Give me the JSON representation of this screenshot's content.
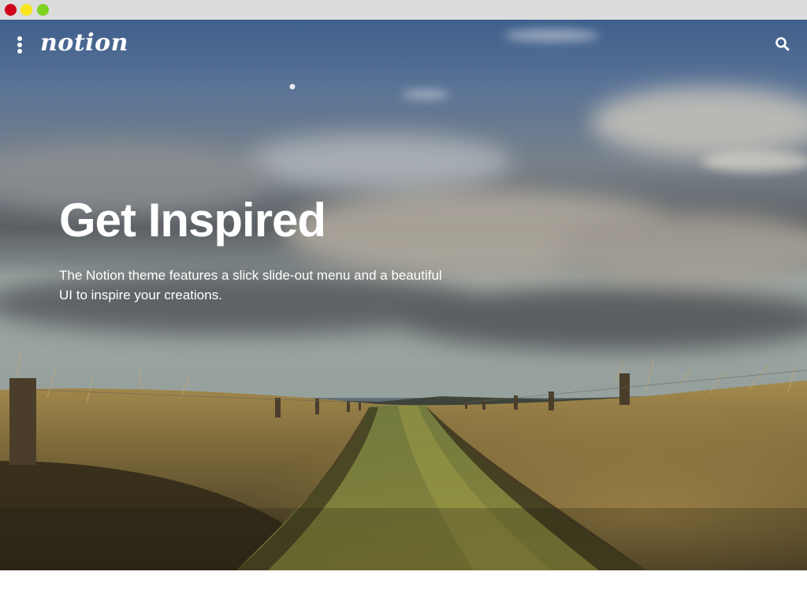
{
  "window": {
    "controls": [
      "close",
      "minimize",
      "maximize"
    ]
  },
  "nav": {
    "logo": "notion",
    "menu_icon": "vertical-dots-icon",
    "search_icon": "search-icon"
  },
  "hero": {
    "title": "Get Inspired",
    "text": "The Notion theme features a slick slide-out menu and a beautiful UI to inspire your creations.",
    "background": "sky-over-grass-field-with-dirt-path"
  },
  "colors": {
    "text": "#ffffff",
    "close": "#d0021b",
    "minimize": "#f8e71c",
    "maximize": "#7ed321",
    "chrome": "#dcdcdc"
  }
}
